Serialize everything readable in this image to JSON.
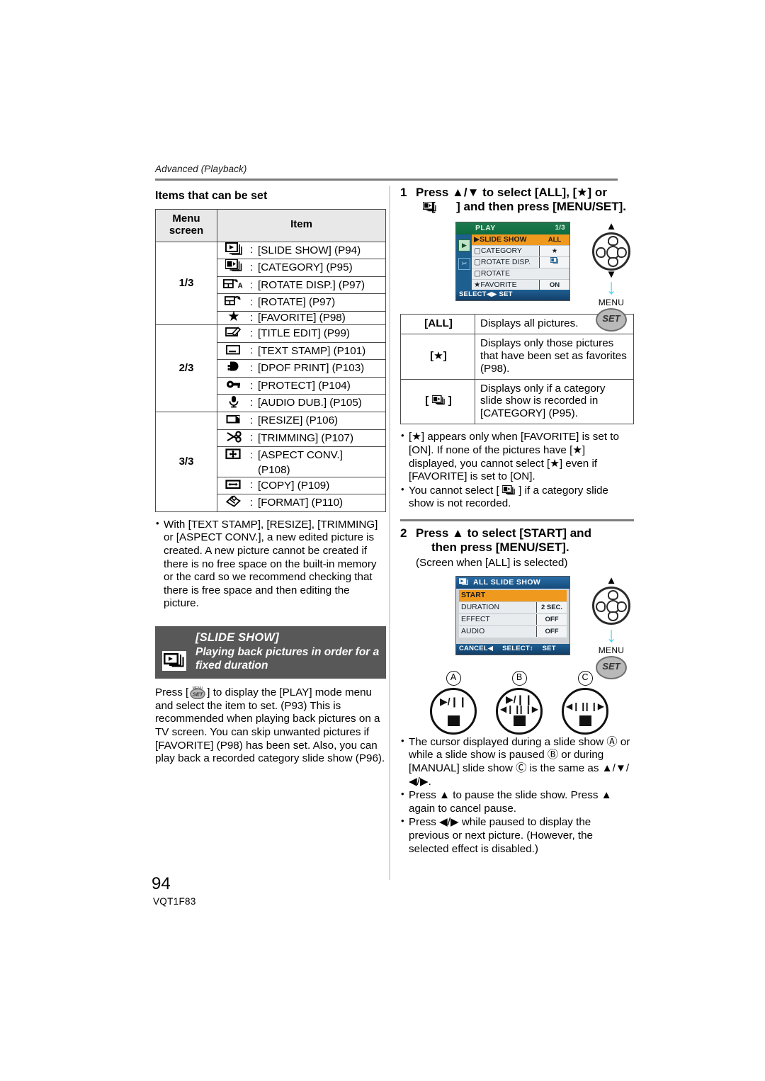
{
  "page": {
    "running_head": "Advanced (Playback)",
    "number": "94",
    "doc_code": "VQT1F83"
  },
  "left": {
    "section_title": "Items that can be set",
    "table": {
      "headers": [
        "Menu screen",
        "Item"
      ],
      "header_line1": "Menu",
      "header_line2": "screen",
      "header_item": "Item",
      "groups": [
        {
          "label": "1/3",
          "rows": [
            {
              "icon": "slide-show-icon",
              "text": "[SLIDE SHOW] (P94)"
            },
            {
              "icon": "category-icon",
              "text": "[CATEGORY] (P95)"
            },
            {
              "icon": "rotate-disp-icon",
              "text": "[ROTATE DISP.] (P97)"
            },
            {
              "icon": "rotate-icon",
              "text": "[ROTATE] (P97)"
            },
            {
              "icon": "favorite-star-icon",
              "text": "[FAVORITE] (P98)"
            }
          ]
        },
        {
          "label": "2/3",
          "rows": [
            {
              "icon": "title-edit-icon",
              "text": "[TITLE EDIT] (P99)"
            },
            {
              "icon": "text-stamp-icon",
              "text": "[TEXT STAMP] (P101)"
            },
            {
              "icon": "dpof-print-icon",
              "text": "[DPOF PRINT] (P103)"
            },
            {
              "icon": "protect-key-icon",
              "text": "[PROTECT] (P104)"
            },
            {
              "icon": "audio-dub-mic-icon",
              "text": "[AUDIO DUB.] (P105)"
            }
          ]
        },
        {
          "label": "3/3",
          "rows": [
            {
              "icon": "resize-icon",
              "text": "[RESIZE] (P106)"
            },
            {
              "icon": "trimming-scissors-icon",
              "text": "[TRIMMING] (P107)"
            },
            {
              "icon": "aspect-conv-icon",
              "text": "[ASPECT CONV.]",
              "text2": "(P108)"
            },
            {
              "icon": "copy-icon",
              "text": "[COPY] (P109)"
            },
            {
              "icon": "format-icon",
              "text": "[FORMAT] (P110)"
            }
          ]
        }
      ]
    },
    "note_bullet": "With [TEXT STAMP], [RESIZE], [TRIMMING] or [ASPECT CONV.], a new edited picture is created. A new picture cannot be created if there is no free space on the built-in memory or the card so we recommend checking that there is free space and then editing the picture.",
    "banner": {
      "title": "[SLIDE SHOW]",
      "subtitle": "Playing back pictures in order for a fixed duration",
      "icon": "slide-show-icon"
    },
    "body_paragraph": "Press [        ] to display the [PLAY] mode menu and select the item to set. (P93) This is recommended when playing back pictures on a TV screen. You can skip unwanted pictures if [FAVORITE] (P98) has been set. Also, you can play back a recorded category slide show (P96)."
  },
  "right": {
    "step1": {
      "number": "1",
      "text_line1": "Press ▲/▼ to select [ALL], [★] or",
      "text_line2": "[      ] and then press [MENU/SET]."
    },
    "lcd1": {
      "title": "PLAY",
      "page_indicator": "1/3",
      "side_icons": [
        "play-tab-icon",
        "wrench-setup-tab-icon"
      ],
      "rows": [
        {
          "label": "SLIDE SHOW",
          "value": "ALL",
          "selected": true
        },
        {
          "label": "CATEGORY",
          "value": "★",
          "selected": false
        },
        {
          "label": "ROTATE DISP.",
          "value": "category-icon",
          "selected": false
        },
        {
          "label": "ROTATE",
          "value": "",
          "selected": false
        },
        {
          "label": "FAVORITE",
          "value": "ON",
          "selected": false
        }
      ],
      "bottom_bar": "SELECT◀▶ SET"
    },
    "dpad1": {
      "up": "▲",
      "down": "▼",
      "menu_label": "MENU",
      "set_label": "SET"
    },
    "options_table": [
      {
        "key": "[ALL]",
        "desc": "Displays all pictures."
      },
      {
        "key": "[★]",
        "desc": "Displays only those pictures that have been set as favorites (P98)."
      },
      {
        "key": "[category-icon]",
        "desc": "Displays only if a category slide show is recorded in [CATEGORY] (P95)."
      }
    ],
    "bullets1": [
      "[★] appears only when [FAVORITE] is set to [ON]. If none of the pictures have [★] displayed, you cannot select [★] even if [FAVORITE] is set to [ON].",
      "You cannot select [      ] if a category slide show is not recorded."
    ],
    "step2": {
      "number": "2",
      "text_line1": "Press ▲ to select [START] and",
      "text_line2": "then press [MENU/SET].",
      "note": "(Screen when [ALL] is selected)"
    },
    "lcd2": {
      "title": "ALL SLIDE SHOW",
      "rows": [
        {
          "label": "START",
          "value": "",
          "selected": true
        },
        {
          "label": "DURATION",
          "value": "2 SEC.",
          "selected": false
        },
        {
          "label": "EFFECT",
          "value": "OFF",
          "selected": false
        },
        {
          "label": "AUDIO",
          "value": "OFF",
          "selected": false
        }
      ],
      "bottom_bar_left": "CANCEL◀",
      "bottom_bar_mid": "SELECT↕",
      "bottom_bar_right": "SET"
    },
    "dpad2": {
      "up": "▲",
      "menu_label": "MENU",
      "set_label": "SET"
    },
    "abc": [
      {
        "label": "A",
        "glyphs": [
          "play-pause-icon",
          "stop-icon"
        ]
      },
      {
        "label": "B",
        "glyphs": [
          "play-pause-icon",
          "prev-icon",
          "next-icon",
          "stop-icon"
        ]
      },
      {
        "label": "C",
        "glyphs": [
          "prev-icon",
          "next-icon",
          "stop-icon"
        ]
      }
    ],
    "bullets2": [
      "The cursor displayed during a slide show Ⓐ or while a slide show is paused Ⓑ or during [MANUAL] slide show Ⓒ is the same as ▲/▼/◀/▶.",
      "Press ▲ to pause the slide show. Press ▲ again to cancel pause.",
      "Press ◀/▶ while paused to display the previous or next picture. (However, the selected effect is disabled.)"
    ]
  },
  "colors": {
    "banner_bg": "#585858",
    "table_header_bg": "#e8e8e8",
    "lcd_selected": "#ef9a1e",
    "lcd_green_bar": "#1d7a4f",
    "lcd_blue_bar": "#1f5f93",
    "arrow_cyan": "#4ad7f0"
  }
}
